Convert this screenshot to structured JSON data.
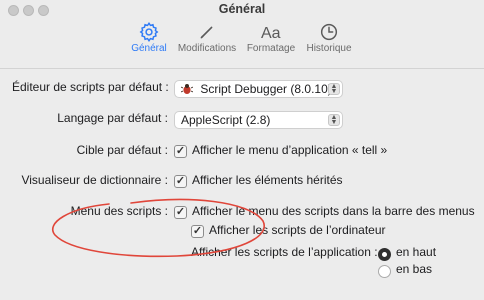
{
  "window": {
    "title": "Général"
  },
  "tabs": [
    {
      "label": "Général",
      "icon": "gear-icon",
      "active": true
    },
    {
      "label": "Modifications",
      "icon": "pencil-icon",
      "active": false
    },
    {
      "label": "Formatage",
      "icon": "text-format-icon",
      "active": false
    },
    {
      "label": "Historique",
      "icon": "clock-icon",
      "active": false
    }
  ],
  "settings": {
    "editor": {
      "label": "Éditeur de scripts par défaut :",
      "value": "Script Debugger (8.0.10)"
    },
    "language": {
      "label": "Langage par défaut :",
      "value": "AppleScript (2.8)"
    },
    "target": {
      "label": "Cible par défaut :",
      "checkbox": "Afficher le menu d’application « tell »",
      "checked": true
    },
    "dictionary": {
      "label": "Visualiseur de dictionnaire :",
      "checkbox": "Afficher les éléments hérités",
      "checked": true
    },
    "scripts_menu": {
      "label": "Menu des scripts :",
      "checkbox": "Afficher le menu des scripts dans la barre des menus",
      "checked": true,
      "computer_checkbox": "Afficher les scripts de l’ordinateur",
      "computer_checked": true,
      "app_scripts_label": "Afficher les scripts de l’application :",
      "options": [
        {
          "label": "en haut",
          "selected": true
        },
        {
          "label": "en bas",
          "selected": false
        }
      ]
    }
  },
  "colors": {
    "accent": "#2f7bf6",
    "annotation": "#e0463a"
  }
}
